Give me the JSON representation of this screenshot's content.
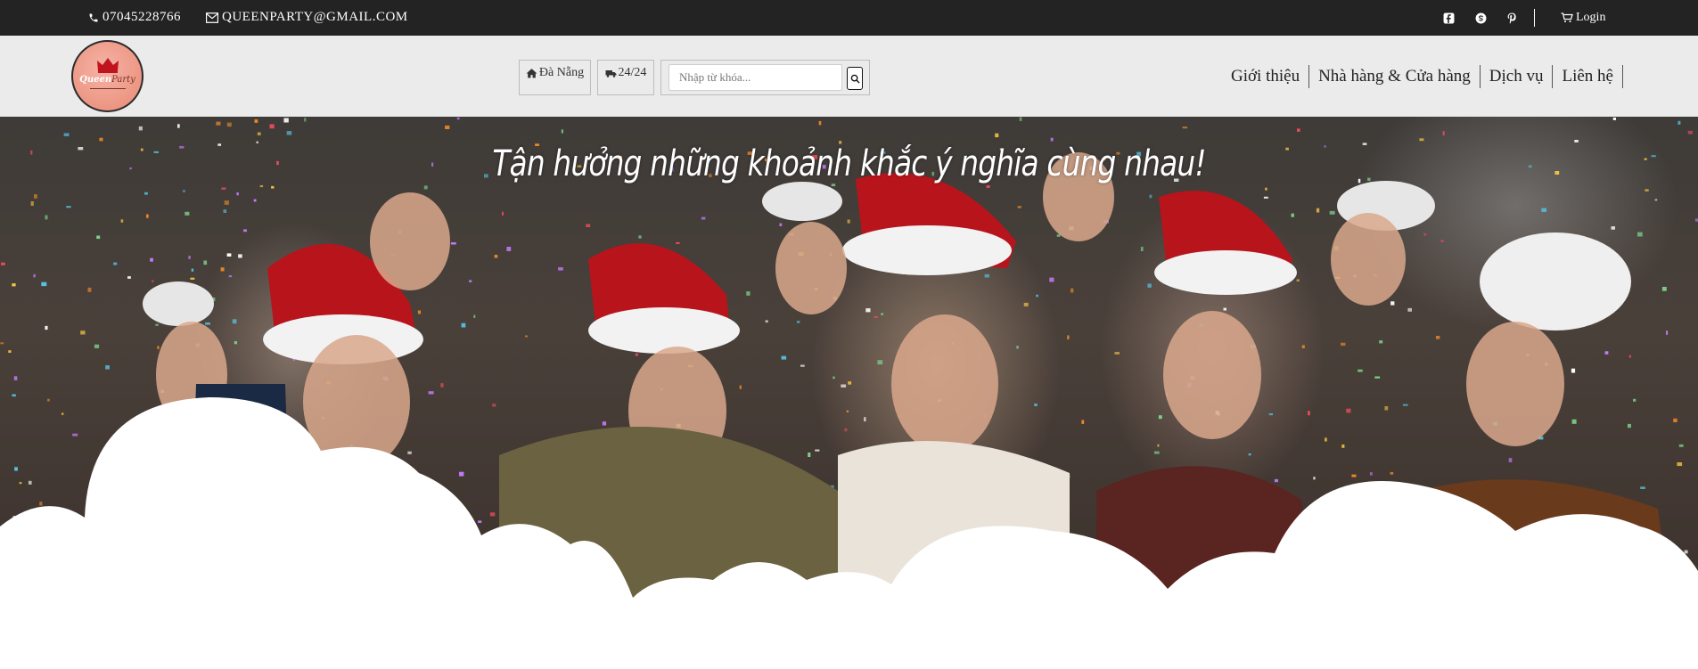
{
  "topbar": {
    "phone": "07045228766",
    "email": "QUEENPARTY@GMAIL.COM",
    "social": [
      "facebook-icon",
      "skype-icon",
      "pinterest-icon"
    ],
    "login_label": "Login"
  },
  "header": {
    "logo": {
      "brand_main": "Queen",
      "brand_sub": "Party"
    },
    "location_label": "Đà Nẵng",
    "hours_label": "24/24",
    "search": {
      "placeholder": "Nhập từ khóa...",
      "value": ""
    },
    "nav": [
      "Giới thiệu",
      "Nhà hàng & Cửa hàng",
      "Dịch vụ",
      "Liên hệ"
    ]
  },
  "hero": {
    "title": "Tận hưởng những khoảnh khắc ý nghĩa cùng nhau!"
  },
  "colors": {
    "topbar_bg": "#232323",
    "header_bg": "#ebebeb",
    "logo_bg": "#ee9a88",
    "santa_red": "#c0151f"
  }
}
